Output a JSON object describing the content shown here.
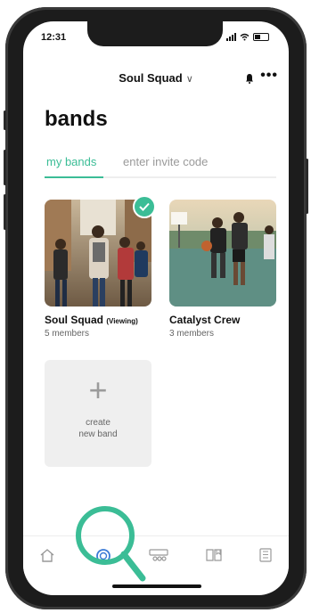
{
  "status": {
    "time": "12:31"
  },
  "header": {
    "team_name": "Soul Squad",
    "chevron": "∨",
    "more": "•••"
  },
  "page": {
    "title": "bands"
  },
  "tabs": [
    {
      "label": "my bands"
    },
    {
      "label": "enter invite code"
    }
  ],
  "bands": [
    {
      "name": "Soul Squad",
      "tag": "(Viewing)",
      "meta": "5 members"
    },
    {
      "name": "Catalyst Crew",
      "tag": "",
      "meta": "3 members"
    }
  ],
  "create": {
    "plus": "+",
    "line1": "create",
    "line2": "new band"
  },
  "nav": [
    "home-icon",
    "bands-icon",
    "roster-icon",
    "book-icon",
    "setlist-icon"
  ],
  "colors": {
    "accent": "#3bbd96",
    "phone": "#1c1c1c"
  }
}
